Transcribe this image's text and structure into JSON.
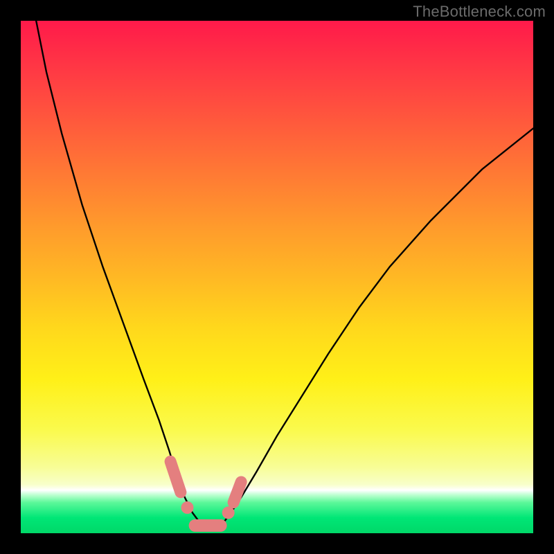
{
  "watermark": "TheBottleneck.com",
  "chart_data": {
    "type": "line",
    "title": "",
    "xlabel": "",
    "ylabel": "",
    "xlim": [
      0,
      100
    ],
    "ylim": [
      0,
      100
    ],
    "grid": false,
    "series": [
      {
        "name": "bottleneck-curve",
        "x": [
          3,
          5,
          8,
          12,
          16,
          20,
          24,
          27,
          29,
          30.5,
          32,
          33.5,
          35,
          36.5,
          38,
          39.5,
          41,
          43,
          46,
          50,
          55,
          60,
          66,
          72,
          80,
          90,
          100
        ],
        "values": [
          100,
          90,
          78,
          64,
          52,
          41,
          30,
          22,
          16,
          11,
          7,
          4,
          2,
          1,
          1,
          2,
          4,
          7,
          12,
          19,
          27,
          35,
          44,
          52,
          61,
          71,
          79
        ]
      }
    ],
    "annotations": [
      {
        "name": "marker-cluster-left",
        "x": 30.5,
        "y": 10
      },
      {
        "name": "marker-cluster-bottom",
        "x": 36,
        "y": 1
      },
      {
        "name": "marker-cluster-right",
        "x": 41.5,
        "y": 6
      }
    ],
    "colors": {
      "curve": "#000000",
      "marker": "#e47f7f",
      "gradient_top": "#ff1a4a",
      "gradient_mid": "#ffd81c",
      "gradient_bottom": "#00d868"
    }
  }
}
